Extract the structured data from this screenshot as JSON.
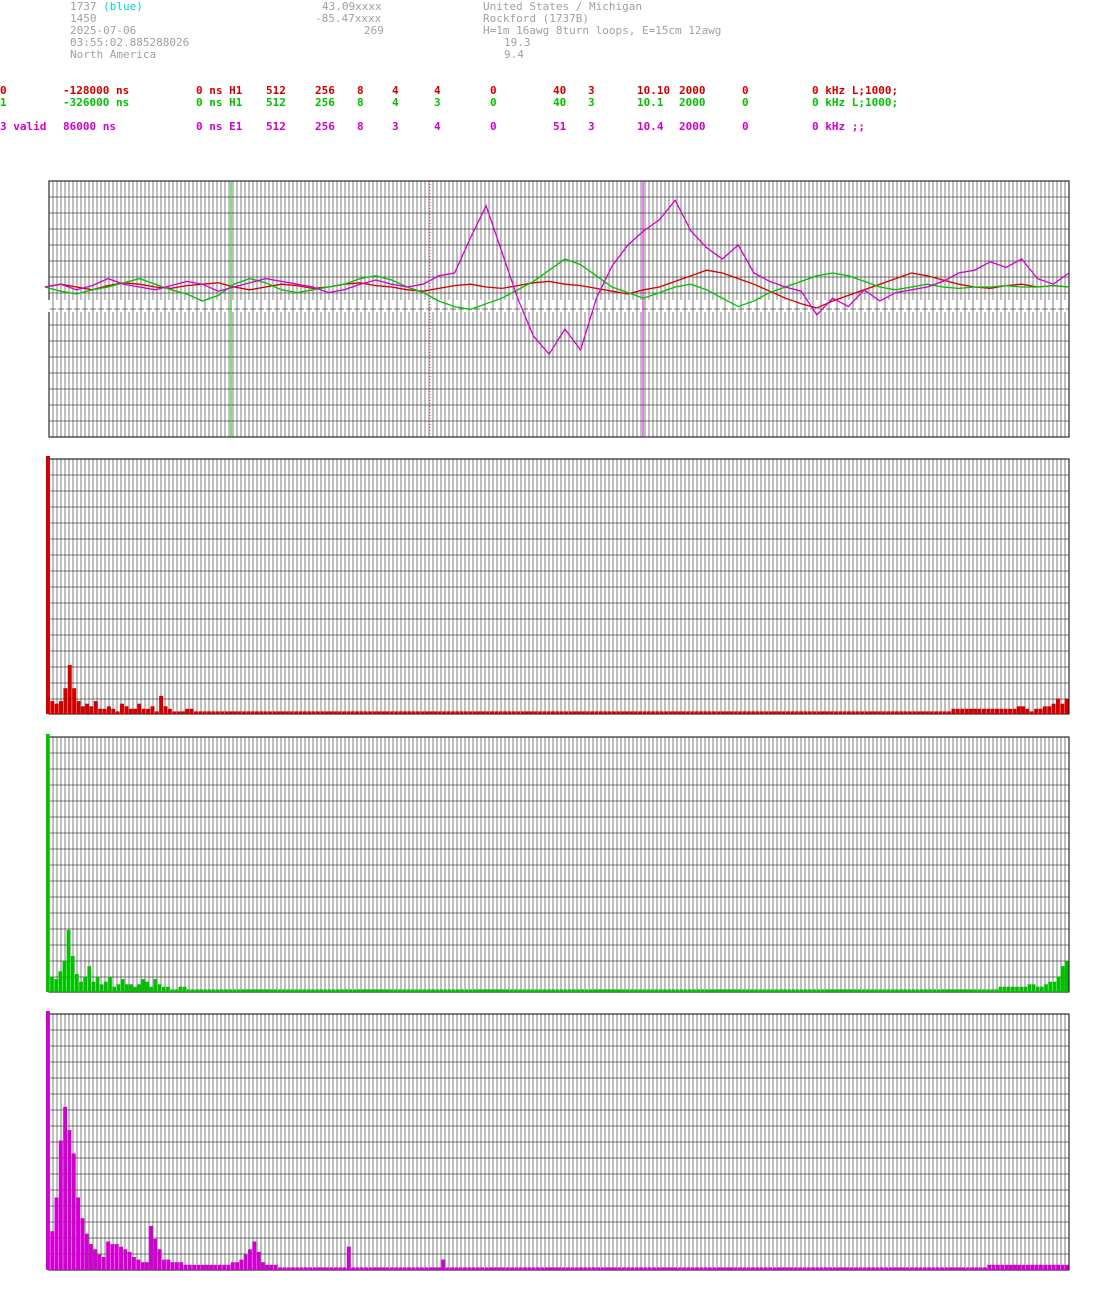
{
  "header": {
    "station_id": "1737",
    "color_note": "(blue)",
    "number": "1450",
    "date": "2025-07-06",
    "time": "03:55:02.885288026",
    "region": "North America",
    "lat": "43.09xxxx",
    "lon": "-85.47xxxx",
    "alt": "269",
    "country": "United States / Michigan",
    "site": "Rockford (1737B)",
    "antenna": "H=1m 16awg 8turn loops, E=15cm 12awg",
    "val1": "19.3",
    "val2": "9.4"
  },
  "channels": [
    {
      "c0": "0",
      "c1": "-128000 ns",
      "c2": "0 ns H1",
      "c3": "512",
      "c4": "256",
      "c5": "8",
      "c6": "4",
      "c7": "4",
      "c8": "0",
      "c9": "40",
      "c10": "3",
      "c11": "10.10",
      "c12": "2000",
      "c13": "0",
      "c14": "0 kHz L;1000;"
    },
    {
      "c0": "1",
      "c1": "-326000 ns",
      "c2": "0 ns H1",
      "c3": "512",
      "c4": "256",
      "c5": "8",
      "c6": "4",
      "c7": "3",
      "c8": "0",
      "c9": "40",
      "c10": "3",
      "c11": "10.1",
      "c12": "2000",
      "c13": "0",
      "c14": "0 kHz L;1000;"
    },
    {
      "c0": "3 valid",
      "c1": "86000 ns",
      "c2": "0 ns E1",
      "c3": "512",
      "c4": "256",
      "c5": "8",
      "c6": "3",
      "c7": "4",
      "c8": "0",
      "c9": "51",
      "c10": "3",
      "c11": "10.4",
      "c12": "2000",
      "c13": "0",
      "c14": "0 kHz ;;"
    }
  ],
  "colors": {
    "red": "#d00000",
    "green": "#00c000",
    "magenta": "#d000d0",
    "grid": "#000000"
  },
  "chart_data": [
    {
      "type": "line",
      "series": [
        {
          "color": "red",
          "values": [
            0,
            2,
            0,
            -2,
            1,
            3,
            2,
            0,
            -1,
            1,
            2,
            3,
            0,
            -2,
            0,
            2,
            1,
            -1,
            0,
            2,
            3,
            1,
            0,
            -2,
            -3,
            -1,
            1,
            2,
            0,
            -1,
            1,
            3,
            4,
            2,
            1,
            -1,
            -3,
            -5,
            -2,
            0,
            4,
            8,
            12,
            10,
            6,
            2,
            -3,
            -8,
            -12,
            -15,
            -10,
            -6,
            -2,
            2,
            6,
            10,
            8,
            5,
            2,
            0,
            -1,
            1,
            2,
            0,
            1,
            0
          ]
        },
        {
          "color": "green",
          "values": [
            0,
            -3,
            -5,
            -2,
            0,
            3,
            6,
            2,
            -2,
            -5,
            -10,
            -6,
            2,
            6,
            3,
            -2,
            -4,
            -2,
            0,
            2,
            6,
            8,
            5,
            0,
            -4,
            -10,
            -14,
            -16,
            -12,
            -8,
            -2,
            4,
            12,
            20,
            16,
            8,
            0,
            -4,
            -8,
            -4,
            0,
            2,
            -2,
            -8,
            -14,
            -10,
            -4,
            0,
            4,
            8,
            10,
            8,
            4,
            0,
            -2,
            0,
            2,
            0,
            -1,
            0,
            0,
            1,
            0,
            0,
            1,
            0
          ]
        },
        {
          "color": "magenta",
          "values": [
            0,
            2,
            -2,
            1,
            6,
            2,
            0,
            -2,
            1,
            4,
            2,
            -3,
            0,
            3,
            6,
            4,
            2,
            0,
            -4,
            -2,
            2,
            5,
            2,
            0,
            2,
            8,
            10,
            35,
            58,
            25,
            -8,
            -35,
            -48,
            -30,
            -45,
            -8,
            15,
            30,
            40,
            48,
            62,
            40,
            28,
            20,
            30,
            10,
            4,
            0,
            -3,
            -20,
            -8,
            -14,
            -2,
            -10,
            -4,
            -2,
            0,
            4,
            10,
            12,
            18,
            14,
            20,
            6,
            2,
            10
          ]
        }
      ]
    },
    {
      "type": "bar",
      "color": "red",
      "values": [
        100,
        5,
        4,
        5,
        10,
        19,
        10,
        5,
        3,
        4,
        3,
        5,
        2,
        2,
        3,
        2,
        1,
        4,
        3,
        2,
        2,
        4,
        2,
        2,
        3,
        1,
        7,
        3,
        2,
        1,
        1,
        1,
        2,
        2,
        1,
        1,
        1,
        1,
        1,
        1,
        1,
        1,
        1,
        1,
        1,
        1,
        1,
        1,
        1,
        1,
        1,
        1,
        1,
        1,
        1,
        1,
        1,
        1,
        1,
        1,
        1,
        1,
        1,
        1,
        1,
        1,
        1,
        1,
        1,
        1,
        1,
        1,
        1,
        1,
        1,
        1,
        1,
        1,
        1,
        1,
        1,
        1,
        1,
        1,
        1,
        1,
        1,
        1,
        1,
        1,
        1,
        1,
        1,
        1,
        1,
        1,
        1,
        1,
        1,
        1,
        1,
        1,
        1,
        1,
        1,
        1,
        1,
        1,
        1,
        1,
        1,
        1,
        1,
        1,
        1,
        1,
        1,
        1,
        1,
        1,
        1,
        1,
        1,
        1,
        1,
        1,
        1,
        1,
        1,
        1,
        1,
        1,
        1,
        1,
        1,
        1,
        1,
        1,
        1,
        1,
        1,
        1,
        1,
        1,
        1,
        1,
        1,
        1,
        1,
        1,
        1,
        1,
        1,
        1,
        1,
        1,
        1,
        1,
        1,
        1,
        1,
        1,
        1,
        1,
        1,
        1,
        1,
        1,
        1,
        1,
        1,
        1,
        1,
        1,
        1,
        1,
        1,
        1,
        1,
        1,
        1,
        1,
        1,
        1,
        1,
        1,
        1,
        1,
        1,
        1,
        1,
        1,
        1,
        1,
        1,
        1,
        1,
        1,
        1,
        1,
        1,
        1,
        1,
        1,
        1,
        1,
        1,
        1,
        2,
        2,
        2,
        2,
        2,
        2,
        2,
        2,
        2,
        2,
        2,
        2,
        2,
        2,
        2,
        3,
        3,
        2,
        1,
        2,
        2,
        3,
        3,
        4,
        6,
        4,
        6
      ]
    },
    {
      "type": "bar",
      "color": "green",
      "values": [
        100,
        6,
        5,
        8,
        12,
        24,
        14,
        7,
        4,
        6,
        10,
        4,
        6,
        3,
        4,
        6,
        2,
        3,
        5,
        3,
        3,
        2,
        3,
        5,
        4,
        2,
        5,
        3,
        2,
        2,
        1,
        1,
        2,
        2,
        1,
        1,
        1,
        1,
        1,
        1,
        1,
        1,
        1,
        1,
        1,
        1,
        1,
        1,
        1,
        1,
        1,
        1,
        1,
        1,
        1,
        1,
        1,
        1,
        1,
        1,
        1,
        1,
        1,
        1,
        1,
        1,
        1,
        1,
        1,
        1,
        1,
        1,
        1,
        1,
        1,
        1,
        1,
        1,
        1,
        1,
        1,
        1,
        1,
        1,
        1,
        1,
        1,
        1,
        1,
        1,
        1,
        1,
        1,
        1,
        1,
        1,
        1,
        1,
        1,
        1,
        1,
        1,
        1,
        1,
        1,
        1,
        1,
        1,
        1,
        1,
        1,
        1,
        1,
        1,
        1,
        1,
        1,
        1,
        1,
        1,
        1,
        1,
        1,
        1,
        1,
        1,
        1,
        1,
        1,
        1,
        1,
        1,
        1,
        1,
        1,
        1,
        1,
        1,
        1,
        1,
        1,
        1,
        1,
        1,
        1,
        1,
        1,
        1,
        1,
        1,
        1,
        1,
        1,
        1,
        1,
        1,
        1,
        1,
        1,
        1,
        1,
        1,
        1,
        1,
        1,
        1,
        1,
        1,
        1,
        1,
        1,
        1,
        1,
        1,
        1,
        1,
        1,
        1,
        1,
        1,
        1,
        1,
        1,
        1,
        1,
        1,
        1,
        1,
        1,
        1,
        1,
        1,
        1,
        1,
        1,
        1,
        1,
        1,
        1,
        1,
        1,
        1,
        1,
        1,
        1,
        1,
        1,
        1,
        1,
        1,
        1,
        1,
        1,
        1,
        1,
        1,
        1,
        1,
        1,
        1,
        1,
        1,
        1,
        1,
        1,
        1,
        1,
        1,
        1,
        1,
        2,
        2,
        2,
        2,
        2,
        2,
        2,
        3,
        3,
        2,
        2,
        3,
        4,
        4,
        6,
        10,
        12
      ]
    },
    {
      "type": "bar",
      "color": "magenta",
      "values": [
        100,
        15,
        28,
        50,
        63,
        54,
        45,
        28,
        20,
        14,
        10,
        8,
        6,
        5,
        11,
        10,
        10,
        9,
        8,
        7,
        5,
        4,
        3,
        3,
        17,
        12,
        8,
        4,
        4,
        3,
        3,
        3,
        2,
        2,
        2,
        2,
        2,
        2,
        2,
        2,
        2,
        2,
        2,
        3,
        3,
        4,
        6,
        8,
        11,
        7,
        3,
        2,
        2,
        2,
        1,
        1,
        1,
        1,
        1,
        1,
        1,
        1,
        1,
        1,
        1,
        1,
        1,
        1,
        1,
        1,
        9,
        1,
        1,
        1,
        1,
        1,
        1,
        1,
        1,
        1,
        1,
        1,
        1,
        1,
        1,
        1,
        1,
        1,
        1,
        1,
        1,
        1,
        4,
        1,
        1,
        1,
        1,
        1,
        1,
        1,
        1,
        1,
        1,
        1,
        1,
        1,
        1,
        1,
        1,
        1,
        1,
        1,
        1,
        1,
        1,
        1,
        1,
        1,
        1,
        1,
        1,
        1,
        1,
        1,
        1,
        1,
        1,
        1,
        1,
        1,
        1,
        1,
        1,
        1,
        1,
        1,
        1,
        1,
        1,
        1,
        1,
        1,
        1,
        1,
        1,
        1,
        1,
        1,
        1,
        1,
        1,
        1,
        1,
        1,
        1,
        1,
        1,
        1,
        1,
        1,
        1,
        1,
        1,
        1,
        1,
        1,
        1,
        1,
        1,
        1,
        1,
        1,
        1,
        1,
        1,
        1,
        1,
        1,
        1,
        1,
        1,
        1,
        1,
        1,
        1,
        1,
        1,
        1,
        1,
        1,
        1,
        1,
        1,
        1,
        1,
        1,
        1,
        1,
        1,
        1,
        1,
        1,
        1,
        1,
        1,
        1,
        1,
        1,
        1,
        1,
        1,
        1,
        1,
        1,
        1,
        1,
        1,
        1,
        1,
        2,
        2,
        2,
        2,
        2,
        2,
        2,
        2,
        2,
        2,
        2,
        2,
        2,
        2,
        2,
        2,
        2,
        2,
        2
      ]
    }
  ]
}
